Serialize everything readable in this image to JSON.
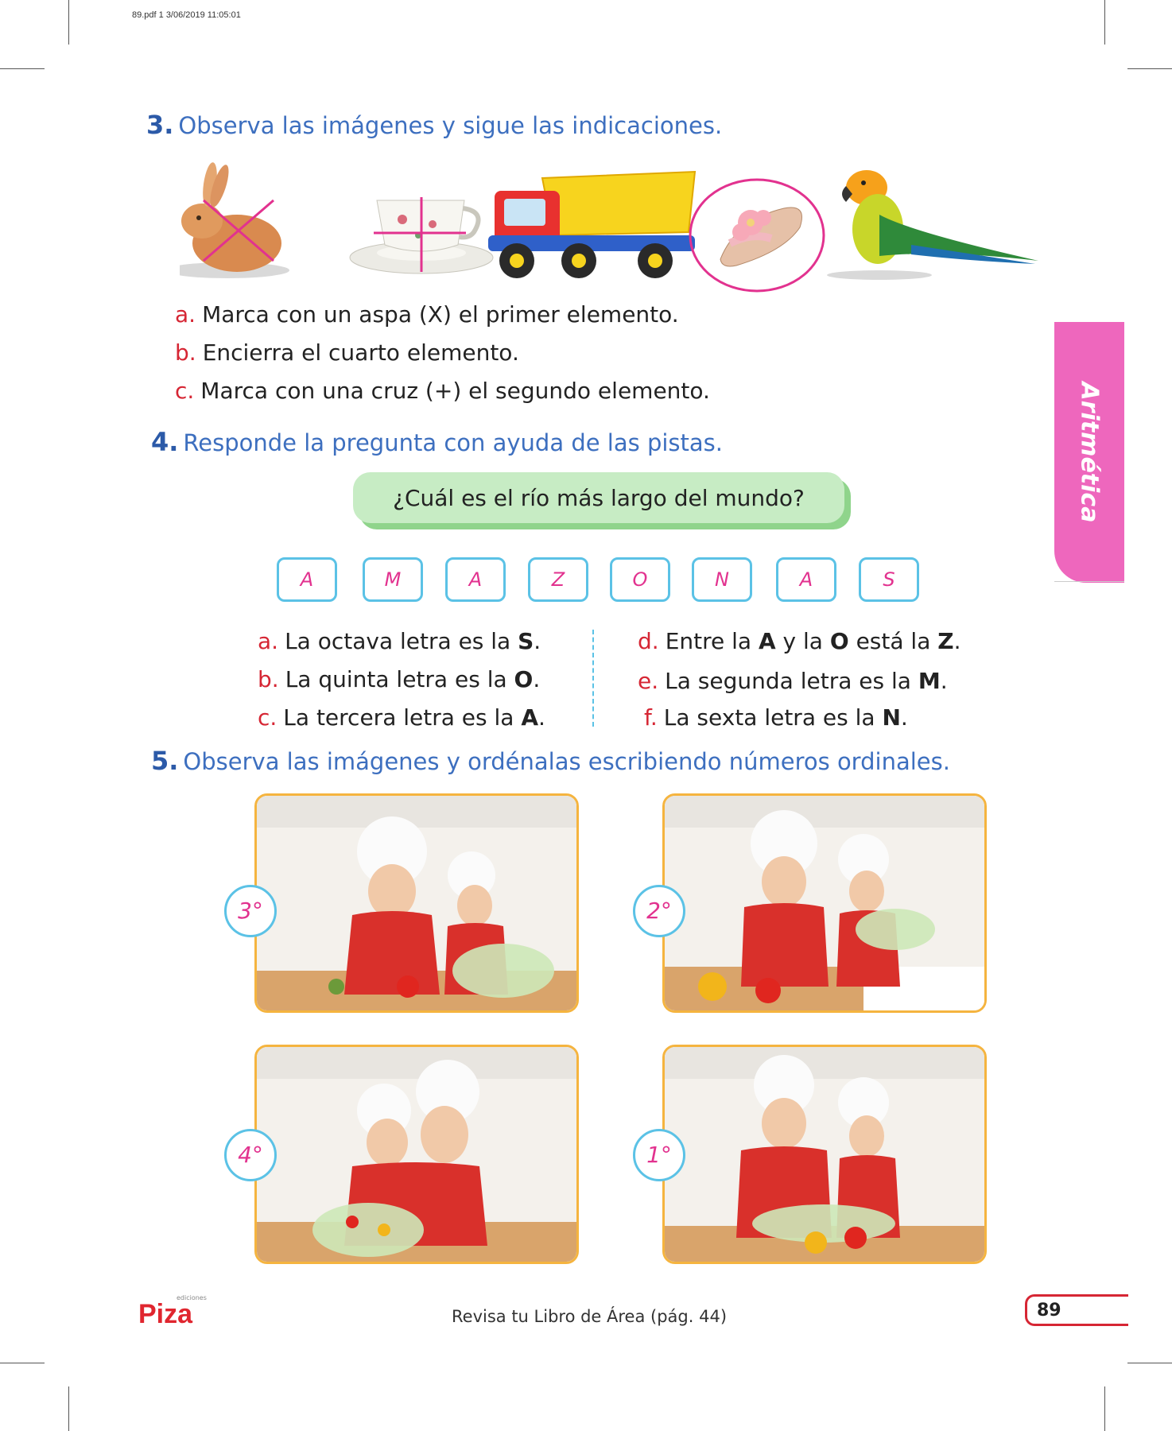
{
  "print_info": "89.pdf   1   3/06/2019   11:05:01",
  "side_tab": "Aritmética",
  "q3": {
    "number": "3.",
    "title": "Observa las imágenes y sigue las indicaciones.",
    "instructions": [
      {
        "letter": "a.",
        "text": "Marca con un aspa (X) el primer elemento."
      },
      {
        "letter": "b.",
        "text": "Encierra el cuarto elemento."
      },
      {
        "letter": "c.",
        "text": "Marca con una cruz (+) el segundo elemento."
      }
    ],
    "images": [
      "rabbit",
      "teacup",
      "toy-truck",
      "sandal",
      "parrot"
    ]
  },
  "q4": {
    "number": "4.",
    "title": "Responde la pregunta con ayuda de las pistas.",
    "question": "¿Cuál es el río más largo del mundo?",
    "letters": [
      "A",
      "M",
      "A",
      "Z",
      "O",
      "N",
      "A",
      "S"
    ],
    "clues_left": [
      {
        "letter": "a.",
        "pre": "La octava letra es la ",
        "bold": "S",
        "post": "."
      },
      {
        "letter": "b.",
        "pre": "La quinta letra es la ",
        "bold": "O",
        "post": "."
      },
      {
        "letter": "c.",
        "pre": "La tercera letra es la ",
        "bold": "A",
        "post": "."
      }
    ],
    "clue_d": {
      "letter": "d.",
      "p1": "Entre la ",
      "b1": "A",
      "p2": " y la ",
      "b2": "O",
      "p3": " está la ",
      "b3": "Z",
      "p4": "."
    },
    "clue_e": {
      "letter": "e.",
      "pre": "La segunda letra es la ",
      "bold": "M",
      "post": "."
    },
    "clue_f": {
      "letter": "f.",
      "pre": "La sexta letra es la ",
      "bold": "N",
      "post": "."
    }
  },
  "q5": {
    "number": "5.",
    "title": "Observa las imágenes y ordénalas escribiendo números ordinales.",
    "ordinals": [
      "3°",
      "2°",
      "4°",
      "1°"
    ]
  },
  "footer": {
    "logo_small": "ediciones",
    "logo": "Piza",
    "note": "Revisa tu Libro de Área (pág. 44)",
    "page": "89"
  },
  "colors": {
    "title_blue": "#3d6fbf",
    "letter_red": "#d62634",
    "pink": "#e2328f",
    "tab_pink": "#ee67bd",
    "box_blue": "#5bc2e6",
    "frame_orange": "#f5b43f",
    "bubble_green": "#c7ecc4"
  }
}
